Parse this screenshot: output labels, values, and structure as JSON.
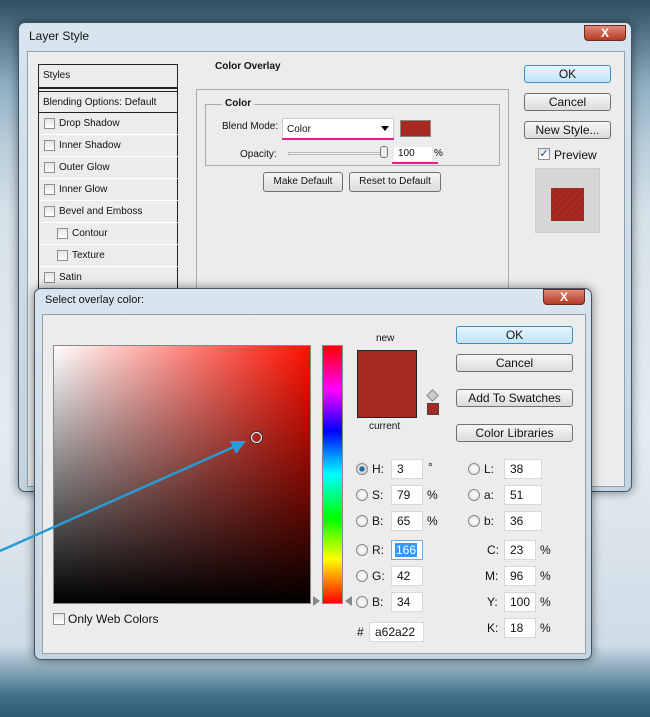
{
  "layer_style": {
    "title": "Layer Style",
    "close": "X",
    "sidebar": [
      "Styles",
      "Blending Options: Default",
      "Drop Shadow",
      "Inner Shadow",
      "Outer Glow",
      "Inner Glow",
      "Bevel and Emboss",
      "Contour",
      "Texture",
      "Satin"
    ],
    "group_title": "Color Overlay",
    "sub_title": "Color",
    "blend_label": "Blend Mode:",
    "blend_value": "Color",
    "opacity_label": "Opacity:",
    "opacity_value": "100",
    "opacity_unit": "%",
    "opacity_percent": 100,
    "make_default": "Make Default",
    "reset_default": "Reset to Default",
    "ok": "OK",
    "cancel": "Cancel",
    "new_style": "New Style...",
    "preview": "Preview",
    "overlay_color": "#a62a22",
    "highlight_color": "#e0208c"
  },
  "picker": {
    "title": "Select overlay color:",
    "close": "X",
    "new_label": "new",
    "current_label": "current",
    "ok": "OK",
    "cancel": "Cancel",
    "add_swatches": "Add To Swatches",
    "color_libraries": "Color Libraries",
    "only_web": "Only Web Colors",
    "fields": {
      "H": "3",
      "S": "79",
      "B": "65",
      "R": "166",
      "G": "42",
      "B2": "34",
      "L": "38",
      "a": "51",
      "b": "36",
      "C": "23",
      "M": "96",
      "Y": "100",
      "K": "18",
      "hex": "a62a22"
    },
    "labels": {
      "H": "H:",
      "S": "S:",
      "B": "B:",
      "R": "R:",
      "G": "G:",
      "B2": "B:",
      "L": "L:",
      "a": "a:",
      "b": "b:",
      "C": "C:",
      "M": "M:",
      "Y": "Y:",
      "K": "K:",
      "hash": "#",
      "deg": "°",
      "pct": "%"
    },
    "color": "#a62a22",
    "annotation_color": "#2a9bd4"
  }
}
